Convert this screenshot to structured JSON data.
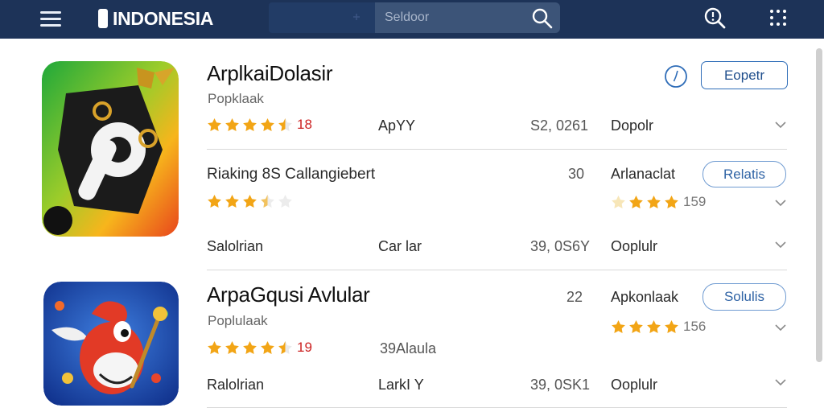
{
  "header": {
    "brand": "INDONESIA",
    "search_placeholder": "Seldoor",
    "icons": [
      "hamburger-menu-icon",
      "search-icon",
      "magnifier-help-icon",
      "grid-dots-icon"
    ],
    "bg_color": "#1d3358"
  },
  "apps": [
    {
      "icon": "p-bomb-app-icon",
      "title": "ArplkaiDolasir",
      "subtitle": "Popklaak",
      "rating_value": "18",
      "stars": 4.5,
      "col2": "ApYY",
      "col3": "S2, 0261",
      "col4": "Dopolr",
      "action": "Eopetr",
      "sub_rows": [
        {
          "title": "Riaking 8S Callangiebert",
          "count": "30",
          "label": "Arlanaclat",
          "action": "Relatis",
          "stars": 3,
          "right_stars": 3,
          "right_rating": "159"
        },
        {
          "c1": "Salolrian",
          "c2": "Car lar",
          "c3": "39, 0S6Y",
          "c4": "Ooplulr"
        }
      ]
    },
    {
      "icon": "red-bird-game-icon",
      "title": "ArpaGqusi Avlular",
      "subtitle": "Poplulaak",
      "rating_value": "19",
      "stars": 4.5,
      "col2": "39Alaula",
      "count": "22",
      "label": "Apkonlaak",
      "action": "Solulis",
      "right_stars": 4,
      "right_rating": "156",
      "bottom": {
        "c1": "Ralolrian",
        "c2": "LarkI Y",
        "c3": "39, 0SK1",
        "c4": "Ooplulr"
      }
    }
  ],
  "colors": {
    "accent": "#2f6db8",
    "star": "#f2a516",
    "rating_red": "#cc2222"
  }
}
